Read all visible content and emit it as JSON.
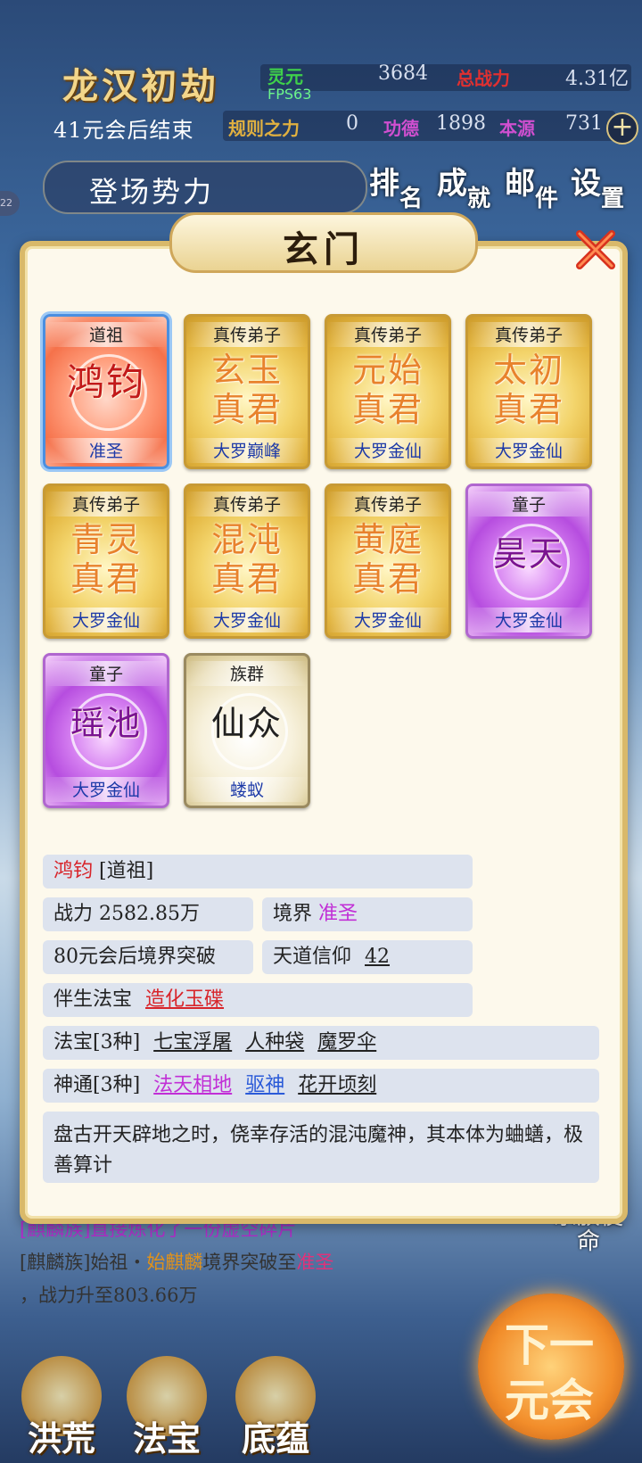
{
  "hud": {
    "title": "龙汉初劫",
    "countdown": "41元会后结束",
    "fps": "FPS63",
    "stats": [
      {
        "label": "灵元",
        "value": "3684",
        "color": "#3fd14a"
      },
      {
        "label": "总战力",
        "value": "4.31亿",
        "color": "#e03030"
      },
      {
        "label": "规则之力",
        "value": "0",
        "color": "#e0b040"
      },
      {
        "label": "功德",
        "value": "1898",
        "color": "#d04fd0"
      },
      {
        "label": "本源",
        "value": "731",
        "color": "#d04fd0"
      }
    ],
    "left_tag": "22",
    "forces_button": "登场势力",
    "top_buttons": [
      {
        "a": "排",
        "b": "名"
      },
      {
        "a": "成",
        "b": "就"
      },
      {
        "a": "邮",
        "b": "件"
      },
      {
        "a": "设",
        "b": "置"
      }
    ]
  },
  "dialog": {
    "title": "玄门",
    "cards": [
      {
        "role": "道祖",
        "name": "鸿钧",
        "realm": "准圣",
        "style": "red",
        "selected": true
      },
      {
        "role": "真传弟子",
        "name": "玄玉真君",
        "realm": "大罗巅峰",
        "style": "gold"
      },
      {
        "role": "真传弟子",
        "name": "元始真君",
        "realm": "大罗金仙",
        "style": "gold"
      },
      {
        "role": "真传弟子",
        "name": "太初真君",
        "realm": "大罗金仙",
        "style": "gold"
      },
      {
        "role": "真传弟子",
        "name": "青灵真君",
        "realm": "大罗金仙",
        "style": "gold"
      },
      {
        "role": "真传弟子",
        "name": "混沌真君",
        "realm": "大罗金仙",
        "style": "gold"
      },
      {
        "role": "真传弟子",
        "name": "黄庭真君",
        "realm": "大罗金仙",
        "style": "gold"
      },
      {
        "role": "童子",
        "name": "昊天",
        "realm": "大罗金仙",
        "style": "purple"
      },
      {
        "role": "童子",
        "name": "瑶池",
        "realm": "大罗金仙",
        "style": "purple"
      },
      {
        "role": "族群",
        "name": "仙众",
        "realm": "蝼蚁",
        "style": "white"
      }
    ],
    "info": {
      "name": "鸿钧",
      "role_tag": "[道祖]",
      "power_label": "战力",
      "power_value": "2582.85万",
      "realm_label": "境界",
      "realm_value": "准圣",
      "breakthrough": "80元会后境界突破",
      "faith_label": "天道信仰",
      "faith_value": "42",
      "companion_label": "伴生法宝",
      "companion_value": "造化玉碟",
      "treasures_label": "法宝[3种]",
      "treasures": [
        "七宝浮屠",
        "人种袋",
        "魔罗伞"
      ],
      "powers_label": "神通[3种]",
      "powers": [
        {
          "name": "法天相地",
          "color": "#c12fd6"
        },
        {
          "name": "驱神",
          "color": "#2a5ad8"
        },
        {
          "name": "花开顷刻",
          "color": "#222222"
        }
      ],
      "description": "盘古开天辟地之时，侥幸存活的混沌魔神，其本体为蛐蟮，极善算计"
    }
  },
  "log": {
    "line1_tag": "[麒麟族]",
    "line1_text": "直接炼化了一份虚空碎片",
    "line2_tag": "[麒麟族]",
    "line2_a": "始祖・",
    "line2_name": "始麒麟",
    "line2_b": "境界突破至",
    "line2_realm": "准圣",
    "line3": "，战力升至803.66万"
  },
  "side_label": "宗族使命",
  "bottom_nav": [
    "洪荒",
    "法宝",
    "底蕴"
  ],
  "next_button": {
    "l1": "下一",
    "l2": "元会"
  }
}
